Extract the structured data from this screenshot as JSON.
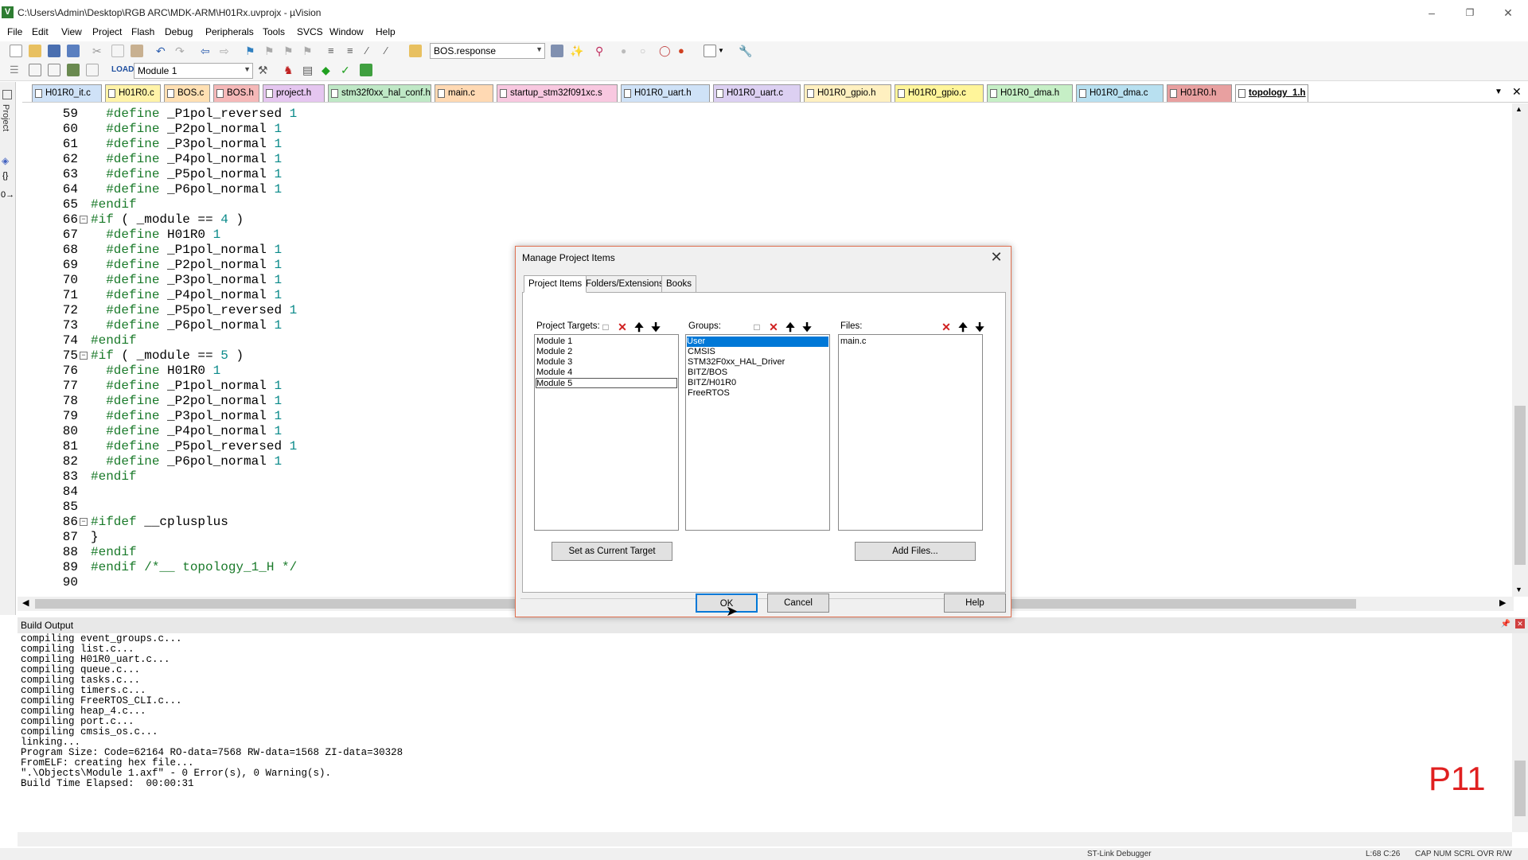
{
  "window": {
    "title": "C:\\Users\\Admin\\Desktop\\RGB ARC\\MDK-ARM\\H01Rx.uvprojx - µVision"
  },
  "menu": [
    "File",
    "Edit",
    "View",
    "Project",
    "Flash",
    "Debug",
    "Peripherals",
    "Tools",
    "SVCS",
    "Window",
    "Help"
  ],
  "toolbar": {
    "find_combo": "BOS.response",
    "target_combo": "Module 1"
  },
  "file_tabs": [
    {
      "label": "H01R0_it.c",
      "color": "#cfe2f7"
    },
    {
      "label": "H01R0.c",
      "color": "#fff3a8"
    },
    {
      "label": "BOS.c",
      "color": "#ffe0b3"
    },
    {
      "label": "BOS.h",
      "color": "#f5b8b8"
    },
    {
      "label": "project.h",
      "color": "#e5c6f0"
    },
    {
      "label": "stm32f0xx_hal_conf.h",
      "color": "#bfe8c6"
    },
    {
      "label": "main.c",
      "color": "#ffd9b3"
    },
    {
      "label": "startup_stm32f091xc.s",
      "color": "#f8c8e0"
    },
    {
      "label": "H01R0_uart.h",
      "color": "#cfe2f7"
    },
    {
      "label": "H01R0_uart.c",
      "color": "#dcd0f2"
    },
    {
      "label": "H01R0_gpio.h",
      "color": "#fff0c0"
    },
    {
      "label": "H01R0_gpio.c",
      "color": "#fff59a"
    },
    {
      "label": "H01R0_dma.h",
      "color": "#c6efc6"
    },
    {
      "label": "H01R0_dma.c",
      "color": "#b8e0f0"
    },
    {
      "label": "H01R0.h",
      "color": "#e8a0a0"
    },
    {
      "label": "topology_1.h",
      "color": "#ffffff"
    }
  ],
  "left_strip": {
    "project_label": "Project"
  },
  "code_lines": [
    {
      "n": "59",
      "ind": "  ",
      "kw": "#define",
      "rest": " _P1pol_reversed ",
      "num": "1",
      "fold": ""
    },
    {
      "n": "60",
      "ind": "  ",
      "kw": "#define",
      "rest": " _P2pol_normal ",
      "num": "1",
      "fold": ""
    },
    {
      "n": "61",
      "ind": "  ",
      "kw": "#define",
      "rest": " _P3pol_normal ",
      "num": "1",
      "fold": ""
    },
    {
      "n": "62",
      "ind": "  ",
      "kw": "#define",
      "rest": " _P4pol_normal ",
      "num": "1",
      "fold": ""
    },
    {
      "n": "63",
      "ind": "  ",
      "kw": "#define",
      "rest": " _P5pol_normal ",
      "num": "1",
      "fold": ""
    },
    {
      "n": "64",
      "ind": "  ",
      "kw": "#define",
      "rest": " _P6pol_normal ",
      "num": "1",
      "fold": ""
    },
    {
      "n": "65",
      "ind": "",
      "kw": "#endif",
      "rest": "",
      "num": "",
      "fold": ""
    },
    {
      "n": "66",
      "ind": "",
      "kw": "#if",
      "rest": " ( _module == ",
      "num": "4",
      "tail": " )",
      "fold": "−"
    },
    {
      "n": "67",
      "ind": "  ",
      "kw": "#define",
      "rest": " H01R0 ",
      "num": "1",
      "fold": ""
    },
    {
      "n": "68",
      "ind": "  ",
      "kw": "#define",
      "rest": " _P1pol_normal ",
      "num": "1",
      "fold": ""
    },
    {
      "n": "69",
      "ind": "  ",
      "kw": "#define",
      "rest": " _P2pol_normal ",
      "num": "1",
      "fold": ""
    },
    {
      "n": "70",
      "ind": "  ",
      "kw": "#define",
      "rest": " _P3pol_normal ",
      "num": "1",
      "fold": ""
    },
    {
      "n": "71",
      "ind": "  ",
      "kw": "#define",
      "rest": " _P4pol_normal ",
      "num": "1",
      "fold": ""
    },
    {
      "n": "72",
      "ind": "  ",
      "kw": "#define",
      "rest": " _P5pol_reversed ",
      "num": "1",
      "fold": ""
    },
    {
      "n": "73",
      "ind": "  ",
      "kw": "#define",
      "rest": " _P6pol_normal ",
      "num": "1",
      "fold": ""
    },
    {
      "n": "74",
      "ind": "",
      "kw": "#endif",
      "rest": "",
      "num": "",
      "fold": ""
    },
    {
      "n": "75",
      "ind": "",
      "kw": "#if",
      "rest": " ( _module == ",
      "num": "5",
      "tail": " )",
      "fold": "−"
    },
    {
      "n": "76",
      "ind": "  ",
      "kw": "#define",
      "rest": " H01R0 ",
      "num": "1",
      "fold": ""
    },
    {
      "n": "77",
      "ind": "  ",
      "kw": "#define",
      "rest": " _P1pol_normal ",
      "num": "1",
      "fold": ""
    },
    {
      "n": "78",
      "ind": "  ",
      "kw": "#define",
      "rest": " _P2pol_normal ",
      "num": "1",
      "fold": ""
    },
    {
      "n": "79",
      "ind": "  ",
      "kw": "#define",
      "rest": " _P3pol_normal ",
      "num": "1",
      "fold": ""
    },
    {
      "n": "80",
      "ind": "  ",
      "kw": "#define",
      "rest": " _P4pol_normal ",
      "num": "1",
      "fold": ""
    },
    {
      "n": "81",
      "ind": "  ",
      "kw": "#define",
      "rest": " _P5pol_reversed ",
      "num": "1",
      "fold": ""
    },
    {
      "n": "82",
      "ind": "  ",
      "kw": "#define",
      "rest": " _P6pol_normal ",
      "num": "1",
      "fold": ""
    },
    {
      "n": "83",
      "ind": "",
      "kw": "#endif",
      "rest": "",
      "num": "",
      "fold": ""
    },
    {
      "n": "84",
      "ind": "",
      "kw": "",
      "rest": "",
      "num": "",
      "fold": ""
    },
    {
      "n": "85",
      "ind": "",
      "kw": "",
      "rest": "",
      "num": "",
      "fold": ""
    },
    {
      "n": "86",
      "ind": "",
      "kw": "#ifdef",
      "rest": " __cplusplus",
      "num": "",
      "fold": "−"
    },
    {
      "n": "87",
      "ind": "",
      "kw": "",
      "rest": "}",
      "num": "",
      "fold": ""
    },
    {
      "n": "88",
      "ind": "",
      "kw": "#endif",
      "rest": "",
      "num": "",
      "fold": ""
    },
    {
      "n": "89",
      "ind": "",
      "kw": "#endif",
      "rest": "",
      "num": "",
      "comment": " /*__ topology_1_H */",
      "fold": ""
    },
    {
      "n": "90",
      "ind": "",
      "kw": "",
      "rest": "",
      "num": "",
      "fold": ""
    }
  ],
  "build": {
    "title": "Build Output",
    "lines": [
      "compiling event_groups.c...",
      "compiling list.c...",
      "compiling H01R0_uart.c...",
      "compiling queue.c...",
      "compiling tasks.c...",
      "compiling timers.c...",
      "compiling FreeRTOS_CLI.c...",
      "compiling heap_4.c...",
      "compiling port.c...",
      "compiling cmsis_os.c...",
      "linking...",
      "Program Size: Code=62164 RO-data=7568 RW-data=1568 ZI-data=30328",
      "FromELF: creating hex file...",
      "\".\\Objects\\Module 1.axf\" - 0 Error(s), 0 Warning(s).",
      "Build Time Elapsed:  00:00:31"
    ],
    "overlay_label": "P11"
  },
  "status": {
    "debugger": "ST-Link Debugger",
    "position": "L:68 C:26",
    "flags": "CAP  NUM  SCRL  OVR  R/W"
  },
  "dialog": {
    "title": "Manage Project Items",
    "tabs": [
      "Project Items",
      "Folders/Extensions",
      "Books"
    ],
    "targets_label": "Project Targets:",
    "groups_label": "Groups:",
    "files_label": "Files:",
    "targets": [
      "Module 1",
      "Module 2",
      "Module 3",
      "Module 4",
      "Module 5"
    ],
    "groups": [
      "User",
      "CMSIS",
      "STM32F0xx_HAL_Driver",
      "BITZ/BOS",
      "BITZ/H01R0",
      "FreeRTOS"
    ],
    "files": [
      "main.c"
    ],
    "selected_group": "User",
    "set_target_btn": "Set as Current Target",
    "add_files_btn": "Add Files...",
    "ok_btn": "OK",
    "cancel_btn": "Cancel",
    "help_btn": "Help"
  }
}
